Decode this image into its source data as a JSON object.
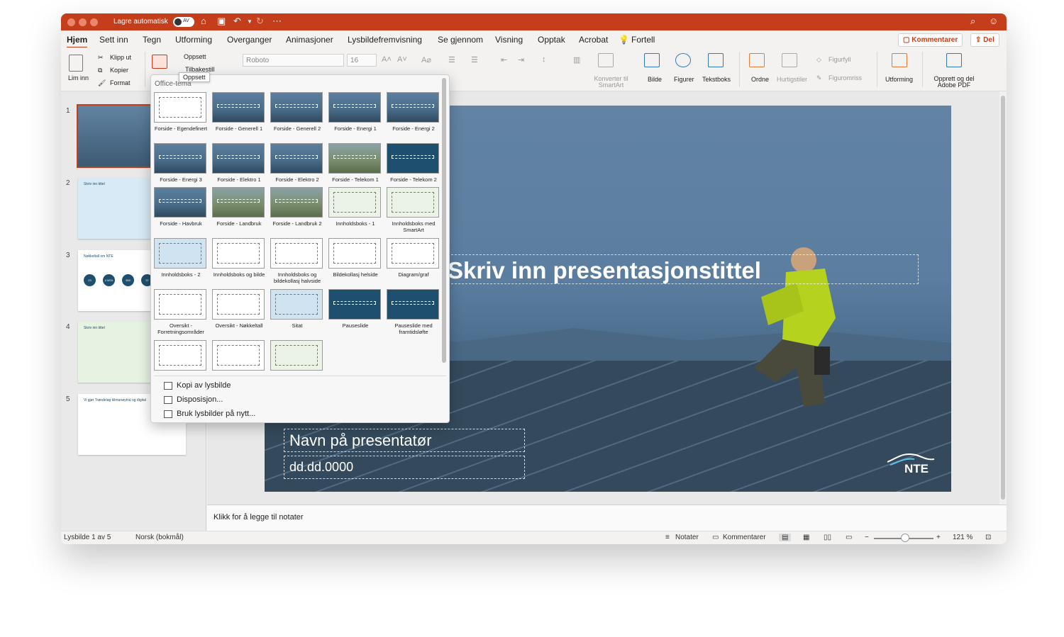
{
  "titlebar": {
    "autosave_label": "Lagre automatisk",
    "autosave_state": "AV",
    "colors": {
      "accent": "#c43e1c"
    }
  },
  "menu": {
    "tabs": [
      "Hjem",
      "Sett inn",
      "Tegn",
      "Utforming",
      "Overganger",
      "Animasjoner",
      "Lysbildefremvisning",
      "Se gjennom",
      "Visning",
      "Opptak",
      "Acrobat"
    ],
    "tell": "Fortell",
    "comments_button": "Kommentarer",
    "share_button": "Del"
  },
  "ribbon": {
    "paste": "Lim inn",
    "cut": "Klipp ut",
    "copy": "Kopier",
    "format": "Format",
    "layout": "Oppsett",
    "reset": "Tilbakestill",
    "font_name": "Roboto",
    "font_size": "16",
    "smartart": "Konverter til SmartArt",
    "picture": "Bilde",
    "shapes": "Figurer",
    "textbox": "Tekstboks",
    "arrange": "Ordne",
    "quick_styles": "Hurtigstiler",
    "shape_fill": "Figurfyll",
    "shape_outline": "Figuromriss",
    "designer": "Utforming",
    "acrobat": "Opprett og del Adobe PDF"
  },
  "tooltip": "Oppsett",
  "dropdown": {
    "header": "Office-tema",
    "layouts": [
      {
        "name": "Forside - Egendefinert",
        "style": "white"
      },
      {
        "name": "Forside - Generell 1",
        "style": "photo"
      },
      {
        "name": "Forside - Generell 2",
        "style": "photo"
      },
      {
        "name": "Forside - Energi 1",
        "style": "photo"
      },
      {
        "name": "Forside - Energi 2",
        "style": "photo"
      },
      {
        "name": "Forside - Energi 3",
        "style": "photo"
      },
      {
        "name": "Forside - Elektro 1",
        "style": "photo"
      },
      {
        "name": "Forside - Elektro 2",
        "style": "photo"
      },
      {
        "name": "Forside - Telekom 1",
        "style": "land"
      },
      {
        "name": "Forside - Telekom 2",
        "style": "dark"
      },
      {
        "name": "Forside - Havbruk",
        "style": "photo"
      },
      {
        "name": "Forside - Landbruk",
        "style": "land"
      },
      {
        "name": "Forside - Landbruk 2",
        "style": "land"
      },
      {
        "name": "Innholdsboks - 1",
        "style": "green"
      },
      {
        "name": "Innholdsboks med SmartArt",
        "style": "green"
      },
      {
        "name": "Innholdsboks - 2",
        "style": "light"
      },
      {
        "name": "Innholdsboks og bilde",
        "style": "white"
      },
      {
        "name": "Innholdsboks og bildekollasj halvside",
        "style": "white"
      },
      {
        "name": "Bildekollasj helside",
        "style": "white"
      },
      {
        "name": "Diagram/graf",
        "style": "white"
      },
      {
        "name": "Oversikt - Forretningsområder",
        "style": "white"
      },
      {
        "name": "Oversikt - Nøkkeltall",
        "style": "white"
      },
      {
        "name": "Sitat",
        "style": "light"
      },
      {
        "name": "Pauseslide",
        "style": "dark"
      },
      {
        "name": "Pauseslide med framtidsløfte",
        "style": "dark"
      },
      {
        "name": "",
        "style": "white"
      },
      {
        "name": "",
        "style": "white"
      },
      {
        "name": "",
        "style": "green"
      }
    ],
    "actions": [
      "Kopi av lysbilde",
      "Disposisjon...",
      "Bruk lysbilder på nytt..."
    ]
  },
  "slides": {
    "numbers": [
      "1",
      "2",
      "3",
      "4",
      "5"
    ],
    "thumb2_title": "Skriv inn tittel",
    "thumb3_title": "Nøkkeltall om NTE",
    "thumb3_values": [
      "23",
      "4 MTA",
      "350",
      "37"
    ],
    "thumb4_title": "Skriv inn tittel",
    "thumb5_title": "Vi gjør Trøndelag klimanøytral og digital"
  },
  "slide": {
    "title": "Skriv inn presentasjonstittel",
    "presenter": "Navn på presentatør",
    "date": "dd.dd.0000",
    "logo": "NTE"
  },
  "notes_placeholder": "Klikk for å legge til notater",
  "status": {
    "slide_counter": "Lysbilde 1 av 5",
    "language": "Norsk (bokmål)",
    "notes": "Notater",
    "comments": "Kommentarer",
    "zoom": "121 %"
  }
}
